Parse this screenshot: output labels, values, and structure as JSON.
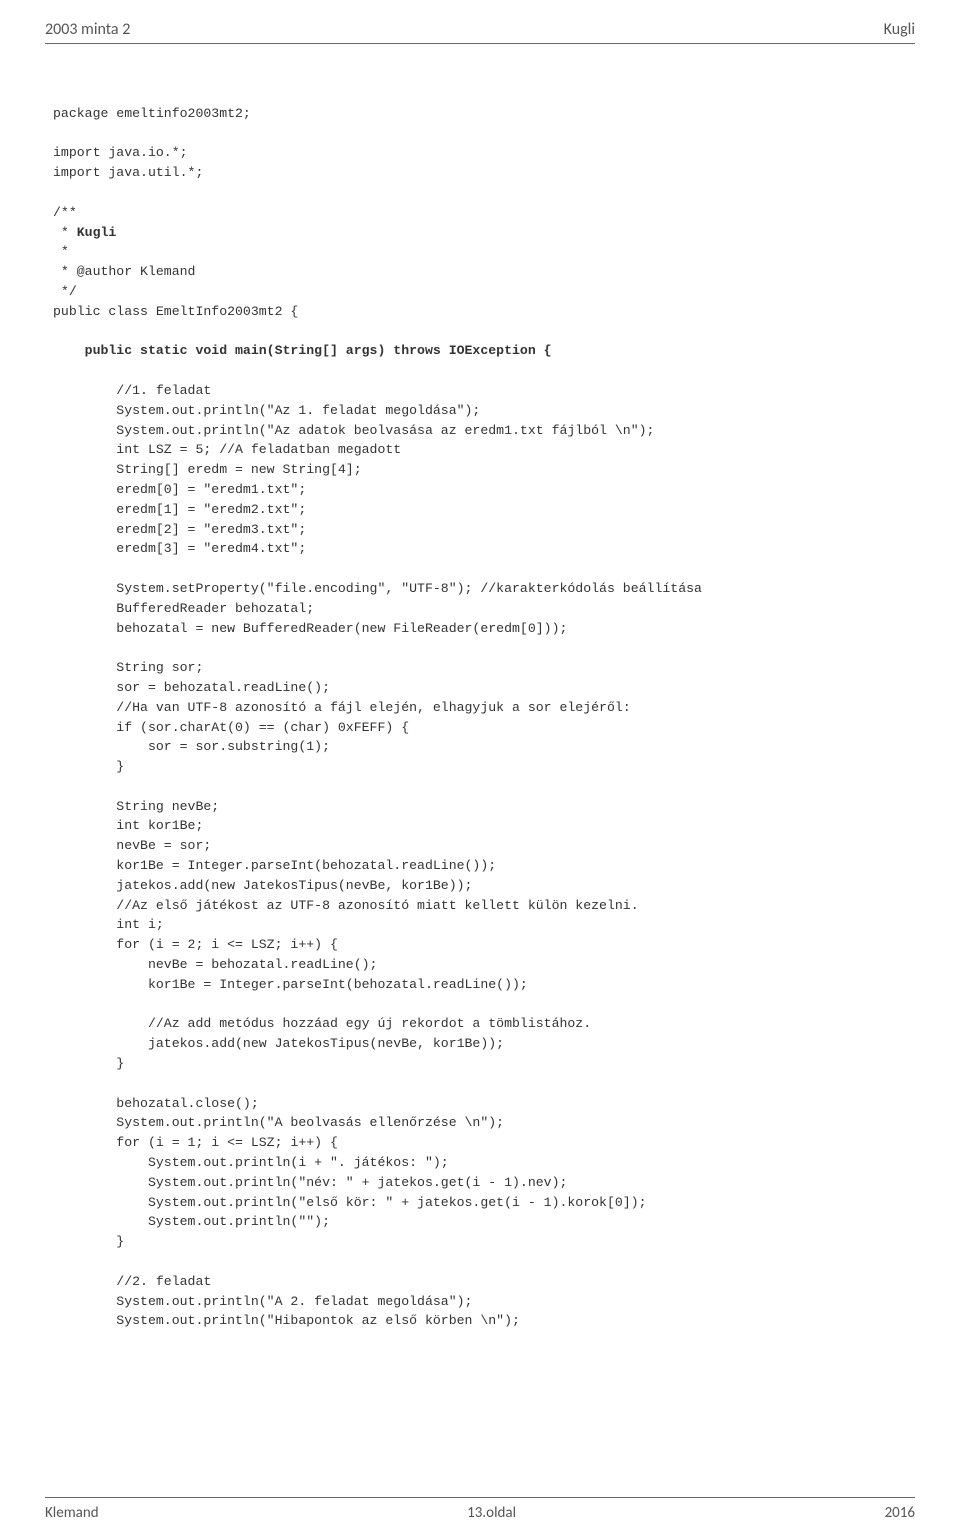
{
  "header": {
    "left": "2003 minta 2",
    "right": "Kugli"
  },
  "footer": {
    "left": "Klemand",
    "center": "13.oldal",
    "right": "2016"
  },
  "code": {
    "l01": "package emeltinfo2003mt2;",
    "l02": "import java.io.*;",
    "l03": "import java.util.*;",
    "l04": "/**",
    "l05": " * ",
    "l05b": "Kugli",
    "l06": " *",
    "l07": " * @author Klemand",
    "l08": " */",
    "l09": "public class EmeltInfo2003mt2 {",
    "l10": "    ",
    "l10b": "public static void main(String[] args) throws IOException {",
    "l11": "        //1. feladat",
    "l12": "        System.out.println(\"Az 1. feladat megoldása\");",
    "l13": "        System.out.println(\"Az adatok beolvasása az eredm1.txt fájlból \\n\");",
    "l14": "        int LSZ = 5; //A feladatban megadott",
    "l15": "        String[] eredm = new String[4];",
    "l16": "        eredm[0] = \"eredm1.txt\";",
    "l17": "        eredm[1] = \"eredm2.txt\";",
    "l18": "        eredm[2] = \"eredm3.txt\";",
    "l19": "        eredm[3] = \"eredm4.txt\";",
    "l20": "        System.setProperty(\"file.encoding\", \"UTF-8\"); //karakterkódolás beállítása",
    "l21": "        BufferedReader behozatal;",
    "l22": "        behozatal = new BufferedReader(new FileReader(eredm[0]));",
    "l23": "        String sor;",
    "l24": "        sor = behozatal.readLine();",
    "l25": "        //Ha van UTF-8 azonosító a fájl elején, elhagyjuk a sor elejéről:",
    "l26": "        if (sor.charAt(0) == (char) 0xFEFF) {",
    "l27": "            sor = sor.substring(1);",
    "l28": "        }",
    "l29": "        String nevBe;",
    "l30": "        int kor1Be;",
    "l31": "        nevBe = sor;",
    "l32": "        kor1Be = Integer.parseInt(behozatal.readLine());",
    "l33": "        jatekos.add(new JatekosTipus(nevBe, kor1Be));",
    "l34": "        //Az első játékost az UTF-8 azonosító miatt kellett külön kezelni.",
    "l35": "        int i;",
    "l36": "        for (i = 2; i <= LSZ; i++) {",
    "l37": "            nevBe = behozatal.readLine();",
    "l38": "            kor1Be = Integer.parseInt(behozatal.readLine());",
    "l39": "            //Az add metódus hozzáad egy új rekordot a tömblistához.",
    "l40": "            jatekos.add(new JatekosTipus(nevBe, kor1Be));",
    "l41": "        }",
    "l42": "        behozatal.close();",
    "l43": "        System.out.println(\"A beolvasás ellenőrzése \\n\");",
    "l44": "        for (i = 1; i <= LSZ; i++) {",
    "l45": "            System.out.println(i + \". játékos: \");",
    "l46": "            System.out.println(\"név: \" + jatekos.get(i - 1).nev);",
    "l47": "            System.out.println(\"első kör: \" + jatekos.get(i - 1).korok[0]);",
    "l48": "            System.out.println(\"\");",
    "l49": "        }",
    "l50": "        //2. feladat",
    "l51": "        System.out.println(\"A 2. feladat megoldása\");",
    "l52": "        System.out.println(\"Hibapontok az első körben \\n\");"
  }
}
